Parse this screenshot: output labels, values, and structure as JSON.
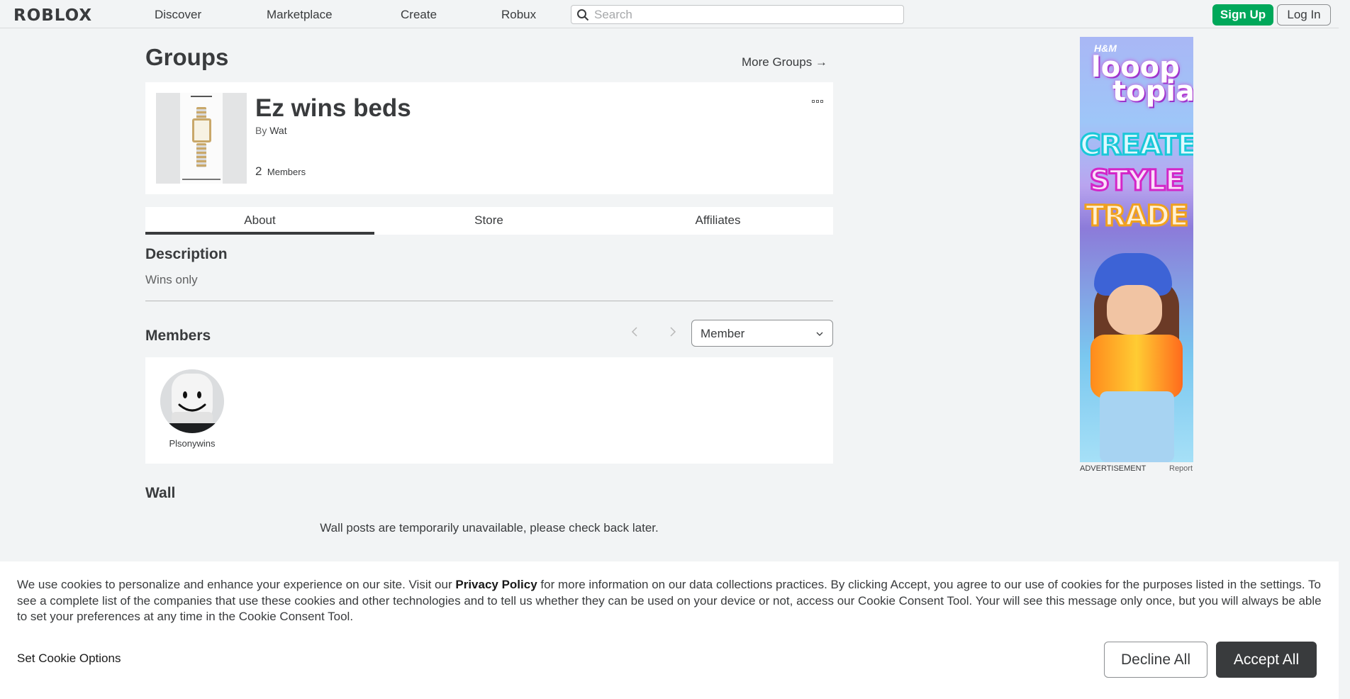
{
  "nav": {
    "logo": "ROBLOX",
    "links": [
      "Discover",
      "Marketplace",
      "Create",
      "Robux"
    ],
    "search_placeholder": "Search",
    "signup_label": "Sign Up",
    "login_label": "Log In"
  },
  "page": {
    "title": "Groups",
    "more_groups_label": "More Groups →"
  },
  "group": {
    "name": "Ez wins beds",
    "by_label": "By",
    "owner": "Wat",
    "member_count": "2",
    "members_label": "Members"
  },
  "tabs": [
    "About",
    "Store",
    "Affiliates"
  ],
  "about": {
    "description_title": "Description",
    "description_text": "Wins only",
    "members_title": "Members",
    "role_select_value": "Member",
    "members": [
      {
        "username": "Plsonywins"
      }
    ],
    "wall_title": "Wall",
    "wall_message": "Wall posts are temporarily unavailable, please check back later."
  },
  "ad": {
    "brand": "H&M",
    "logo_line1": "looop",
    "logo_line2": "topia",
    "words": [
      "CREATE",
      "STYLE",
      "TRADE"
    ],
    "label": "ADVERTISEMENT",
    "report_label": "Report"
  },
  "cookie": {
    "text_before": "We use cookies to personalize and enhance your experience on our site. Visit our ",
    "policy_link": "Privacy Policy",
    "text_after": " for more information on our data collections practices. By clicking Accept, you agree to our use of cookies for the purposes listed in the settings. To see a complete list of the companies that use these cookies and other technologies and to tell us whether they can be used on your device or not, access our Cookie Consent Tool. Your will see this message only once, but you will always be able to set your preferences at any time in the Cookie Consent Tool.",
    "set_options_label": "Set Cookie Options",
    "decline_label": "Decline All",
    "accept_label": "Accept All"
  },
  "colors": {
    "accent_green": "#00a85a",
    "text_dark": "#393b3d",
    "background": "#f2f4f5"
  }
}
